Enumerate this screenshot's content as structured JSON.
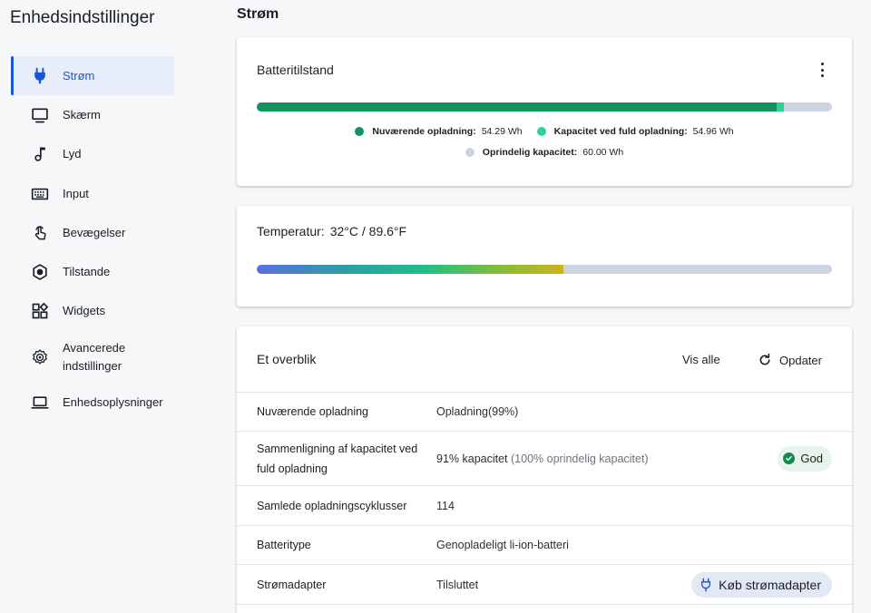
{
  "sidebar": {
    "title": "Enhedsindstillinger",
    "items": [
      {
        "label": "Strøm",
        "icon": "plug-icon"
      },
      {
        "label": "Skærm",
        "icon": "monitor-icon"
      },
      {
        "label": "Lyd",
        "icon": "music-note-icon"
      },
      {
        "label": "Input",
        "icon": "keyboard-icon"
      },
      {
        "label": "Bevægelser",
        "icon": "touch-gesture-icon"
      },
      {
        "label": "Tilstande",
        "icon": "hexagon-mode-icon"
      },
      {
        "label": "Widgets",
        "icon": "widgets-grid-icon"
      },
      {
        "label": "Avancerede indstillinger",
        "icon": "gear-icon"
      },
      {
        "label": "Enhedsoplysninger",
        "icon": "laptop-icon"
      }
    ],
    "active_index": 0
  },
  "main": {
    "title": "Strøm",
    "battery": {
      "title": "Batteritilstand",
      "current_fraction": 0.9035,
      "full_capacity_fraction": 0.916,
      "legend": {
        "current_label": "Nuværende opladning:",
        "current_value": "54.29 Wh",
        "full_label": "Kapacitet ved fuld opladning:",
        "full_value": "54.96 Wh",
        "original_label": "Oprindelig kapacitet:",
        "original_value": "60.00 Wh"
      },
      "colors": {
        "current": "#13945f",
        "full": "#33d096",
        "original": "#ccd4e1"
      }
    },
    "temperature": {
      "label": "Temperatur:",
      "value": "32°C / 89.6°F",
      "fraction": 0.533
    },
    "overview": {
      "title": "Et overblik",
      "show_all": "Vis alle",
      "refresh": "Opdater",
      "rows": [
        {
          "key": "Nuværende opladning",
          "value": "Opladning(99%)",
          "muted": ""
        },
        {
          "key": "Sammenligning af kapacitet ved fuld opladning",
          "value": "91% kapacitet",
          "muted": "(100% oprindelig kapacitet)"
        },
        {
          "key": "Samlede opladningscyklusser",
          "value": "114",
          "muted": ""
        },
        {
          "key": "Batteritype",
          "value": "Genopladeligt li-ion-batteri",
          "muted": ""
        },
        {
          "key": "Strømadapter",
          "value": "Tilsluttet",
          "muted": ""
        }
      ],
      "good_badge": "God",
      "buy_adapter": "Køb strømadapter"
    }
  }
}
